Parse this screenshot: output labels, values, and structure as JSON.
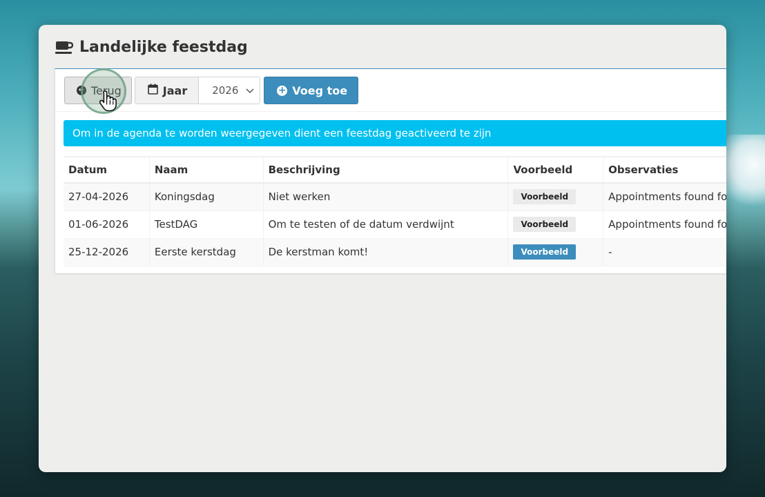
{
  "page": {
    "title": "Landelijke feestdag",
    "title_icon": "coffee-cup-icon"
  },
  "toolbar": {
    "back_label": "Terug",
    "year_label": "Jaar",
    "year_value": "2026",
    "add_label": "Voeg toe"
  },
  "info": {
    "message": "Om in de agenda te worden weergegeven dient een feestdag geactiveerd te zijn"
  },
  "table": {
    "headers": [
      "Datum",
      "Naam",
      "Beschrijving",
      "Voorbeeld",
      "Observaties"
    ],
    "rows": [
      {
        "datum": "27-04-2026",
        "naam": "Koningsdag",
        "beschrijving": "Niet werken",
        "voorbeeld": "Voorbeeld",
        "observaties": "Appointments found fo"
      },
      {
        "datum": "01-06-2026",
        "naam": "TestDAG",
        "beschrijving": "Om te testen of de datum verdwijnt",
        "voorbeeld": "Voorbeeld",
        "observaties": "Appointments found fo"
      },
      {
        "datum": "25-12-2026",
        "naam": "Eerste kerstdag",
        "beschrijving": "De kerstman komt!",
        "voorbeeld": "Voorbeeld",
        "observaties": "-"
      }
    ]
  },
  "colors": {
    "primary": "#3c8dbc",
    "info": "#00c0ef",
    "label_default": "#eaeaea"
  }
}
